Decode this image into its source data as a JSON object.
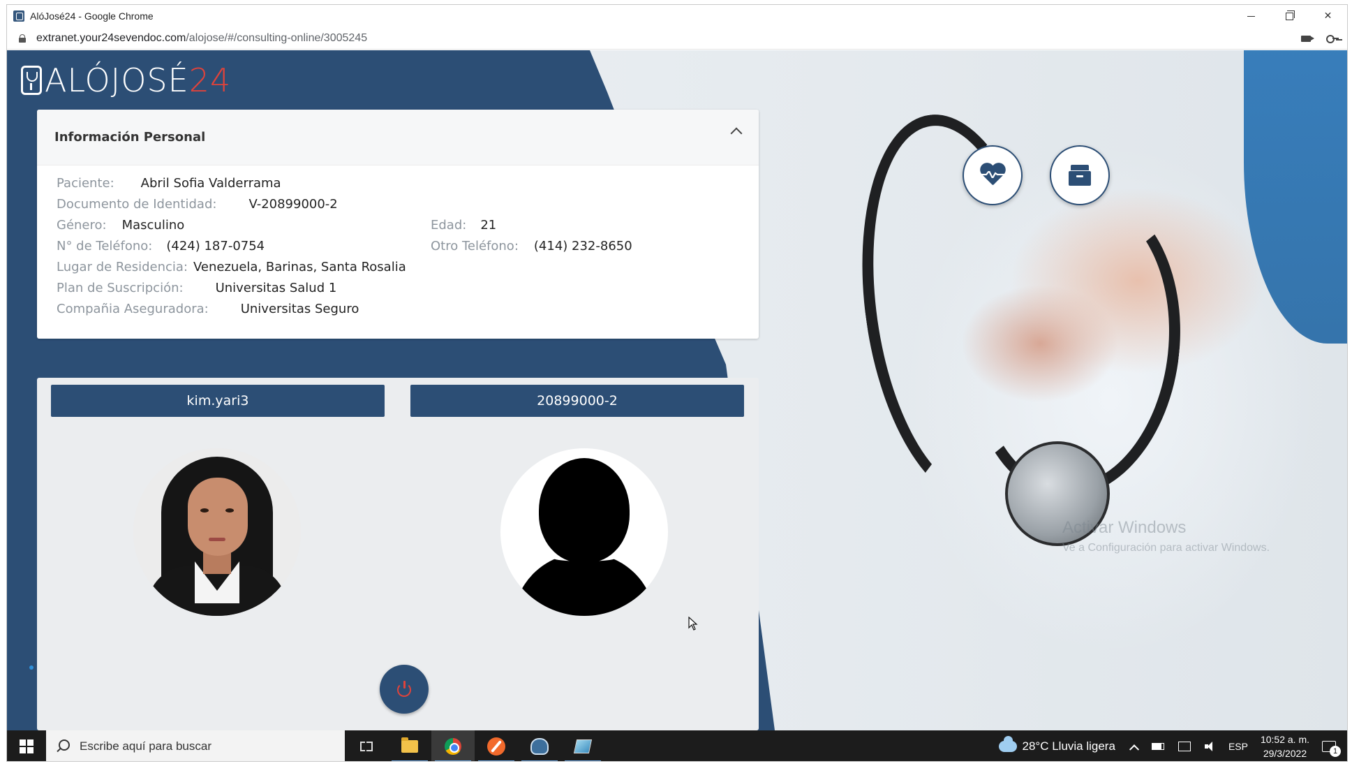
{
  "window": {
    "title": "AlóJosé24 - Google Chrome",
    "url_domain": "extranet.your24sevendoc.com",
    "url_path": "/alojose/#/consulting-online/3005245"
  },
  "logo": {
    "text": "ALÓJOSÉ",
    "number": "24"
  },
  "personal_info": {
    "title": "Información Personal",
    "fields": {
      "paciente_label": "Paciente:",
      "paciente_value": "Abril Sofia Valderrama",
      "documento_label": "Documento de Identidad:",
      "documento_value": "V-20899000-2",
      "genero_label": "Género:",
      "genero_value": "Masculino",
      "edad_label": "Edad:",
      "edad_value": "21",
      "telefono_label": "N° de Teléfono:",
      "telefono_value": "(424) 187-0754",
      "otro_telefono_label": "Otro Teléfono:",
      "otro_telefono_value": "(414) 232-8650",
      "residencia_label": "Lugar de Residencia:",
      "residencia_value": "Venezuela, Barinas, Santa Rosalia",
      "plan_label": "Plan de Suscripción:",
      "plan_value": "Universitas Salud 1",
      "aseguradora_label": "Compañia Aseguradora:",
      "aseguradora_value": "Universitas Seguro"
    }
  },
  "call": {
    "left_participant": "kim.yari3",
    "right_participant": "20899000-2"
  },
  "actions": {
    "vitals_icon": "heartbeat-icon",
    "archive_icon": "archive-icon",
    "hangup_icon": "power-icon"
  },
  "watermark": {
    "line1": "Activar Windows",
    "line2": "Ve a Configuración para activar Windows."
  },
  "taskbar": {
    "search_placeholder": "Escribe aquí para buscar",
    "weather": "28°C  Lluvia ligera",
    "language": "ESP",
    "time": "10:52 a. m.",
    "date": "29/3/2022",
    "notifications_count": "1"
  },
  "colors": {
    "primary": "#2c4e75",
    "accent_red": "#e0433b"
  }
}
